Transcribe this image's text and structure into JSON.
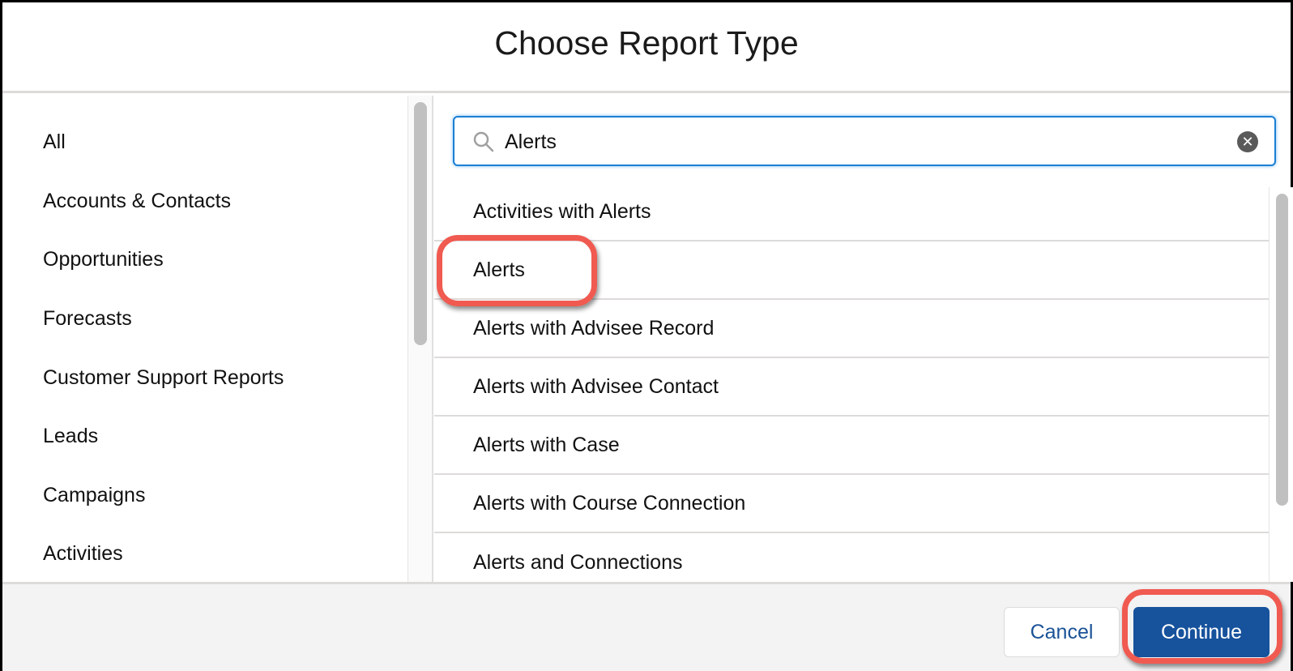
{
  "modal": {
    "title": "Choose Report Type"
  },
  "sidebar": {
    "items": [
      {
        "label": "All"
      },
      {
        "label": "Accounts & Contacts"
      },
      {
        "label": "Opportunities"
      },
      {
        "label": "Forecasts"
      },
      {
        "label": "Customer Support Reports"
      },
      {
        "label": "Leads"
      },
      {
        "label": "Campaigns"
      },
      {
        "label": "Activities"
      }
    ]
  },
  "search": {
    "value": "Alerts",
    "icon": "search-icon",
    "clear_icon": "clear-icon"
  },
  "results": {
    "items": [
      {
        "label": "Activities with Alerts"
      },
      {
        "label": "Alerts",
        "highlighted": true
      },
      {
        "label": "Alerts with Advisee Record"
      },
      {
        "label": "Alerts with Advisee Contact"
      },
      {
        "label": "Alerts with Case"
      },
      {
        "label": "Alerts with Course Connection"
      },
      {
        "label": "Alerts and Connections"
      }
    ]
  },
  "footer": {
    "cancel_label": "Cancel",
    "continue_label": "Continue"
  },
  "colors": {
    "primary": "#17529c",
    "highlight": "#f05a50",
    "focus": "#1b80d4"
  }
}
